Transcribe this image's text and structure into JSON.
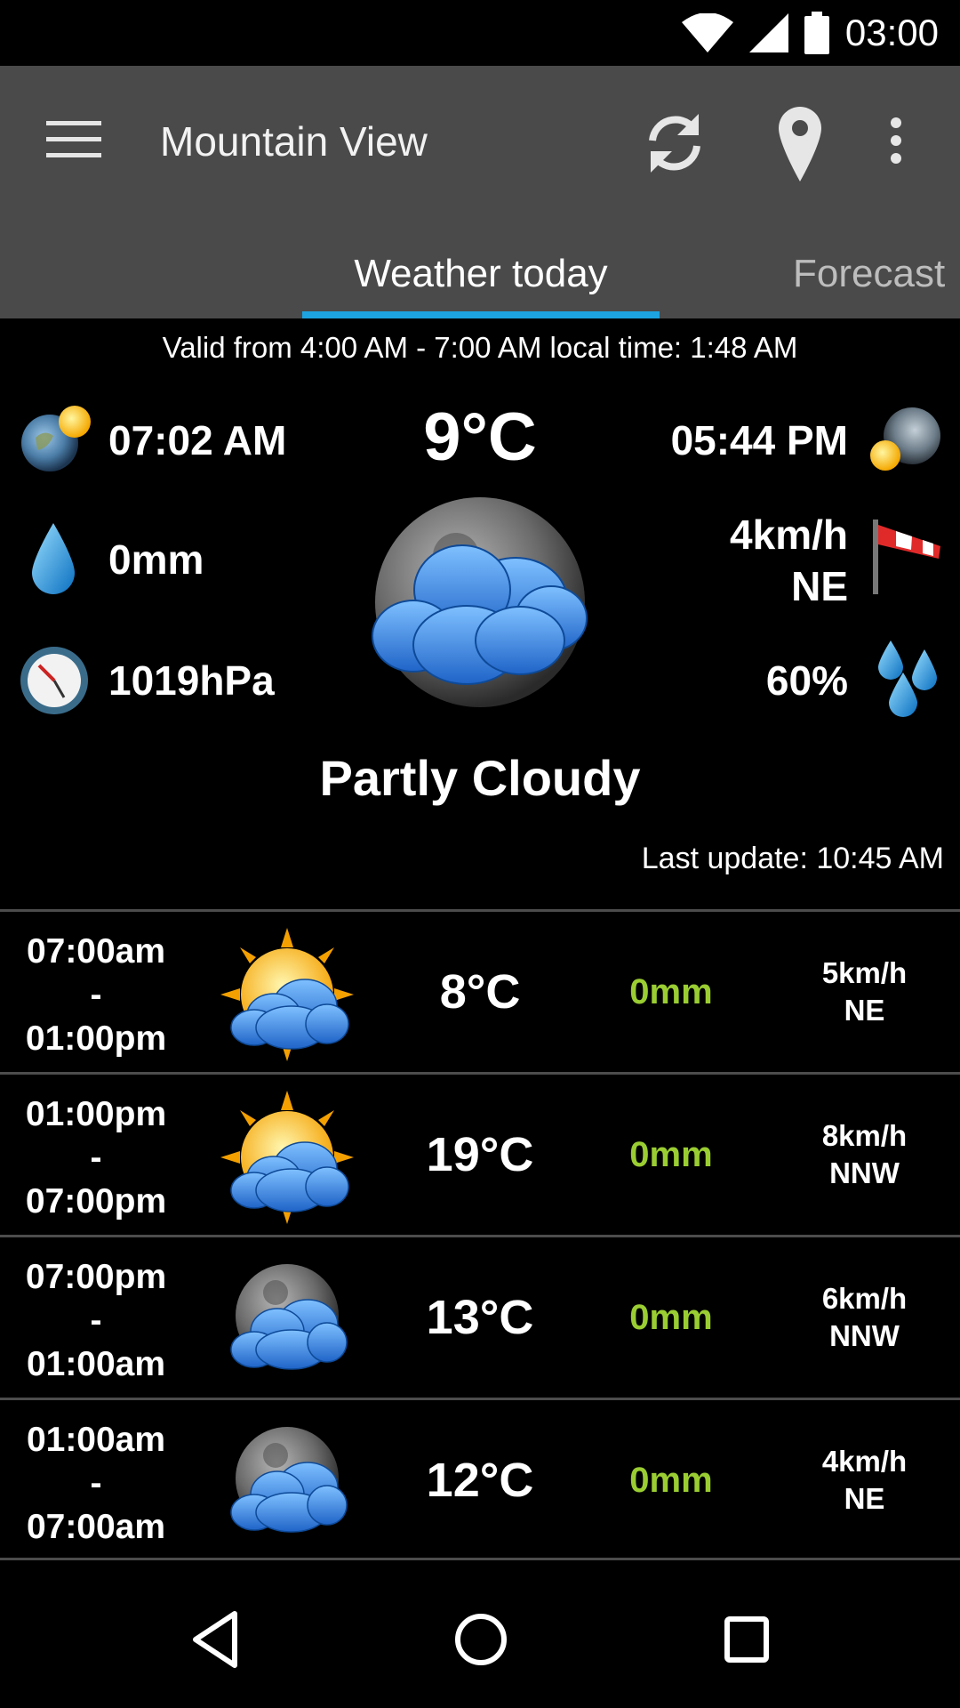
{
  "status_bar": {
    "time": "03:00"
  },
  "toolbar": {
    "title": "Mountain View"
  },
  "tabs": [
    {
      "label": "Weather today",
      "active": true
    },
    {
      "label": "Forecast",
      "active": false
    }
  ],
  "summary": {
    "valid_text": "Valid from 4:00 AM - 7:00 AM local time: 1:48 AM",
    "sunrise": "07:02 AM",
    "sunset": "05:44 PM",
    "temperature": "9°C",
    "precipitation": "0mm",
    "wind_speed": "4km/h",
    "wind_dir": "NE",
    "pressure": "1019hPa",
    "humidity": "60%",
    "condition": "Partly Cloudy",
    "last_update": "Last update: 10:45 AM"
  },
  "forecast": [
    {
      "from": "07:00am",
      "sep": "-",
      "to": "01:00pm",
      "icon": "sun-cloud-icon",
      "temp": "8°C",
      "precip": "0mm",
      "wind_speed": "5km/h",
      "wind_dir": "NE"
    },
    {
      "from": "01:00pm",
      "sep": "-",
      "to": "07:00pm",
      "icon": "sun-cloud-icon",
      "temp": "19°C",
      "precip": "0mm",
      "wind_speed": "8km/h",
      "wind_dir": "NNW"
    },
    {
      "from": "07:00pm",
      "sep": "-",
      "to": "01:00am",
      "icon": "moon-cloud-icon",
      "temp": "13°C",
      "precip": "0mm",
      "wind_speed": "6km/h",
      "wind_dir": "NNW"
    },
    {
      "from": "01:00am",
      "sep": "-",
      "to": "07:00am",
      "icon": "moon-cloud-icon",
      "temp": "12°C",
      "precip": "0mm",
      "wind_speed": "4km/h",
      "wind_dir": "NE"
    }
  ],
  "colors": {
    "app_bar": "#4a4a4a",
    "tab_indicator": "#1ca3e0",
    "precip_green": "#9acd32"
  }
}
